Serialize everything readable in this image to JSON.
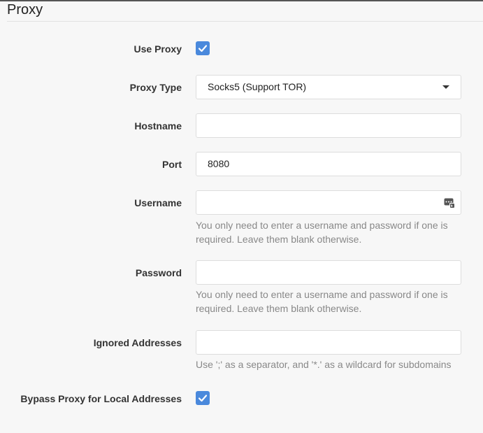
{
  "section": {
    "title": "Proxy"
  },
  "use_proxy": {
    "label": "Use Proxy",
    "checked": true
  },
  "proxy_type": {
    "label": "Proxy Type",
    "value": "Socks5 (Support TOR)"
  },
  "hostname": {
    "label": "Hostname",
    "value": ""
  },
  "port": {
    "label": "Port",
    "value": "8080"
  },
  "username": {
    "label": "Username",
    "value": "",
    "hint": "You only need to enter a username and password if one is required. Leave them blank otherwise.",
    "icon": "password-manager-icon"
  },
  "password": {
    "label": "Password",
    "value": "",
    "hint": "You only need to enter a username and password if one is required. Leave them blank otherwise."
  },
  "ignored_addresses": {
    "label": "Ignored Addresses",
    "value": "",
    "hint": "Use ';' as a separator, and '*.' as a wildcard for subdomains"
  },
  "bypass_local": {
    "label": "Bypass Proxy for Local Addresses",
    "checked": true
  },
  "colors": {
    "accent": "#4a89dc",
    "field_border": "#dddddd",
    "hint_text": "#888888"
  }
}
